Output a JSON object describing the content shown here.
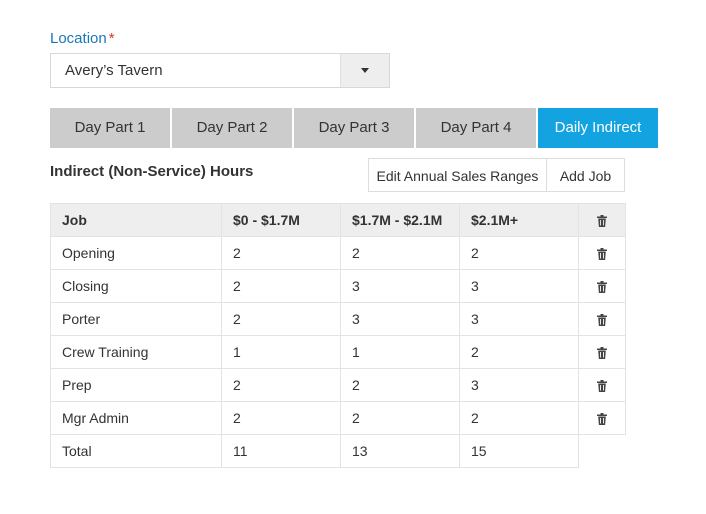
{
  "location": {
    "label": "Location",
    "required_mark": "*",
    "selected": "Avery’s Tavern"
  },
  "tabs": [
    {
      "label": "Day Part 1",
      "active": false
    },
    {
      "label": "Day Part 2",
      "active": false
    },
    {
      "label": "Day Part 3",
      "active": false
    },
    {
      "label": "Day Part 4",
      "active": false
    },
    {
      "label": "Daily Indirect",
      "active": true
    }
  ],
  "section": {
    "title": "Indirect (Non-Service) Hours",
    "edit_button": "Edit Annual Sales Ranges",
    "add_button": "Add Job"
  },
  "table": {
    "headers": [
      "Job",
      "$0 - $1.7M",
      "$1.7M - $2.1M",
      "$2.1M+"
    ],
    "rows": [
      {
        "job": "Opening",
        "c1": "2",
        "c2": "2",
        "c3": "2"
      },
      {
        "job": "Closing",
        "c1": "2",
        "c2": "3",
        "c3": "3"
      },
      {
        "job": "Porter",
        "c1": "2",
        "c2": "3",
        "c3": "3"
      },
      {
        "job": "Crew Training",
        "c1": "1",
        "c2": "1",
        "c3": "2"
      },
      {
        "job": "Prep",
        "c1": "2",
        "c2": "2",
        "c3": "3"
      },
      {
        "job": "Mgr Admin",
        "c1": "2",
        "c2": "2",
        "c3": "2"
      }
    ],
    "total": {
      "label": "Total",
      "c1": "11",
      "c2": "13",
      "c3": "15"
    }
  },
  "icons": {
    "delete": "trash-icon",
    "dropdown": "caret-down-icon"
  },
  "colors": {
    "accent": "#12a3e0",
    "label": "#1b78b8",
    "required": "#d9332b"
  }
}
